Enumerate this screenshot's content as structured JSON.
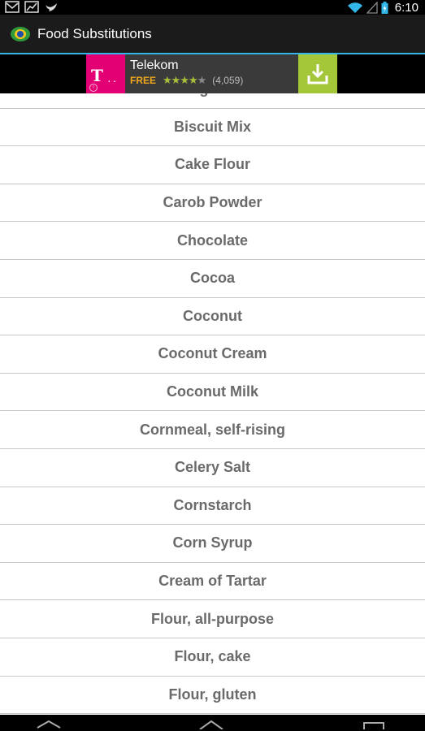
{
  "status_bar": {
    "time": "6:10",
    "icons": [
      "gmail-icon",
      "stocks-icon",
      "bird-icon",
      "wifi-icon",
      "signal-icon",
      "battery-icon"
    ]
  },
  "app_bar": {
    "title": "Food Substitutions",
    "underline_color": "#31b6e7"
  },
  "ad": {
    "name": "Telekom",
    "price": "FREE",
    "rating_stars": 4,
    "rating_count": "(4,059)",
    "brand_color": "#e20074",
    "download_color": "#a4c639"
  },
  "list": {
    "items": [
      "Baking Powder",
      "Biscuit Mix",
      "Cake Flour",
      "Carob Powder",
      "Chocolate",
      "Cocoa",
      "Coconut",
      "Coconut Cream",
      "Coconut Milk",
      "Cornmeal, self-rising",
      "Celery Salt",
      "Cornstarch",
      "Corn Syrup",
      "Cream of Tartar",
      "Flour, all-purpose",
      "Flour, cake",
      "Flour, gluten"
    ]
  },
  "nav_bar": {
    "icons": [
      "back-icon",
      "home-icon",
      "recents-icon"
    ]
  }
}
